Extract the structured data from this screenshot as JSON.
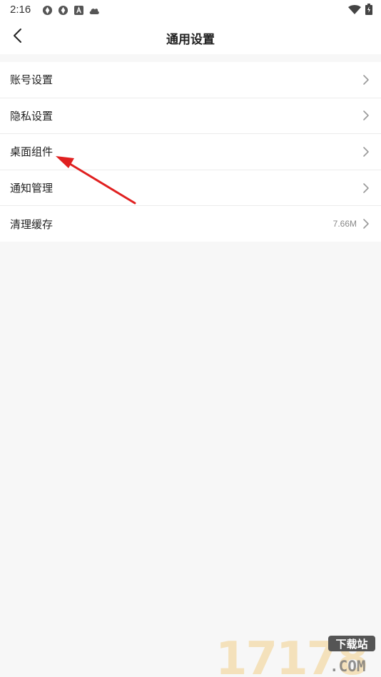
{
  "status_bar": {
    "time": "2:16",
    "icons": [
      "aperture-icon",
      "aperture-icon",
      "a-box-icon",
      "cloud-icon"
    ],
    "right_icons": [
      "wifi-icon",
      "battery-icon"
    ]
  },
  "header": {
    "title": "通用设置",
    "back_icon": "chevron-left-icon"
  },
  "settings": {
    "items": [
      {
        "label": "账号设置",
        "value": ""
      },
      {
        "label": "隐私设置",
        "value": ""
      },
      {
        "label": "桌面组件",
        "value": ""
      },
      {
        "label": "通知管理",
        "value": ""
      },
      {
        "label": "清理缓存",
        "value": "7.66M"
      }
    ]
  },
  "annotation": {
    "arrow_color": "#e02020"
  },
  "watermark": {
    "number": "17178",
    "badge": "下载站",
    "domain": ".COM"
  }
}
